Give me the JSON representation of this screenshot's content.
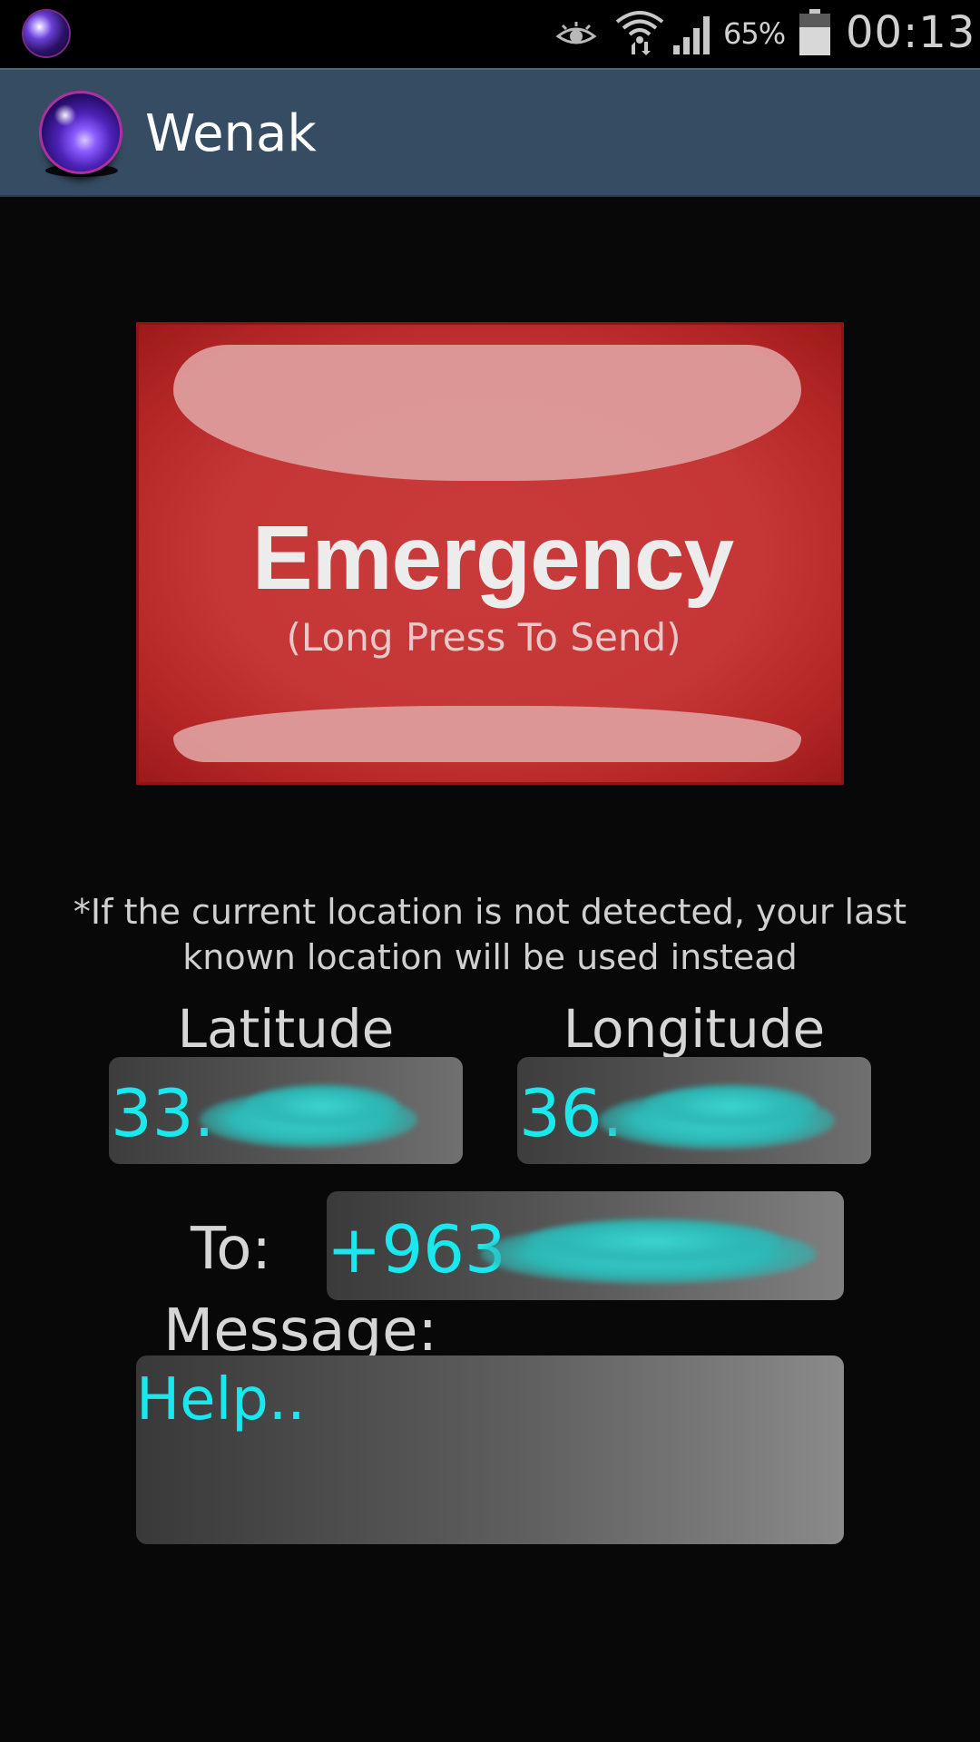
{
  "status_bar": {
    "battery_percent": "65%",
    "clock": "00:13",
    "icons": [
      "app-notification-icon",
      "eye-icon",
      "wifi-icon",
      "signal-icon",
      "battery-icon"
    ]
  },
  "action_bar": {
    "title": "Wenak",
    "logo_icon": "galaxy-orb-icon"
  },
  "emergency": {
    "title": "Emergency",
    "subtitle": "(Long Press To Send)",
    "color": "#c53636"
  },
  "note": "*If the current location is not detected, your last known location will be used instead",
  "location": {
    "latitude_label": "Latitude",
    "latitude_value": "33.",
    "longitude_label": "Longitude",
    "longitude_value": "36."
  },
  "recipient": {
    "label": "To:",
    "value": "+963"
  },
  "message": {
    "label": "Message:",
    "value": "Help.."
  },
  "colors": {
    "accent_text": "#19e9ee",
    "action_bar": "#354c63",
    "background": "#080808"
  }
}
